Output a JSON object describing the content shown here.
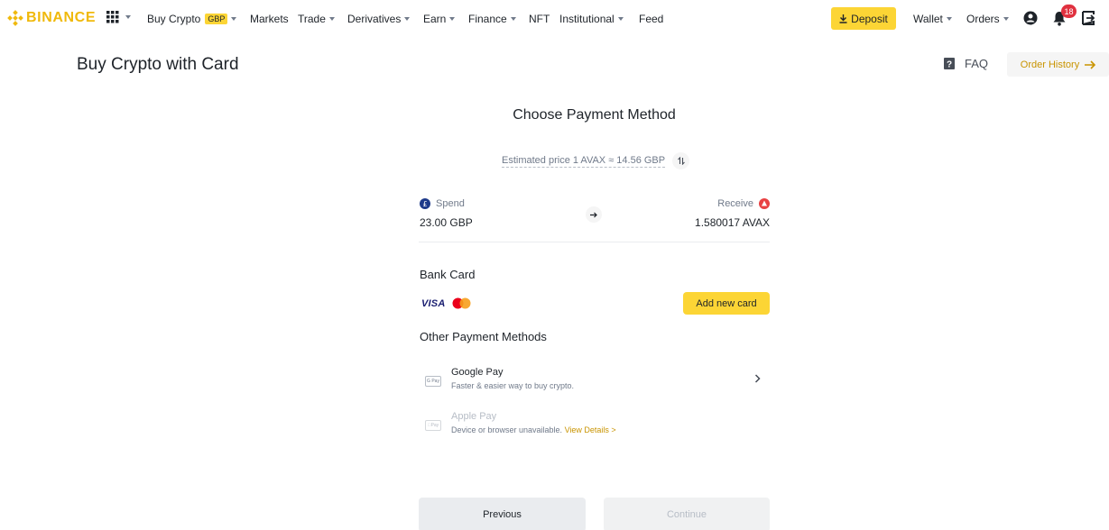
{
  "brand": {
    "name": "BINANCE",
    "color": "#F0B90B"
  },
  "nav": {
    "apps_icon": "grid-icon",
    "buy_crypto": "Buy Crypto",
    "currency_badge": "GBP",
    "markets": "Markets",
    "trade": "Trade",
    "derivatives": "Derivatives",
    "earn": "Earn",
    "finance": "Finance",
    "nft": "NFT",
    "institutional": "Institutional",
    "feed": "Feed",
    "deposit": "Deposit",
    "wallet": "Wallet",
    "orders": "Orders",
    "notification_count": "18"
  },
  "header": {
    "title": "Buy Crypto with Card",
    "faq": "FAQ",
    "order_history": "Order History"
  },
  "panel": {
    "title": "Choose Payment Method",
    "estimated_price": "Estimated price 1 AVAX ≈ 14.56 GBP",
    "spend_label": "Spend",
    "spend_value": "23.00 GBP",
    "receive_label": "Receive",
    "receive_value": "1.580017 AVAX",
    "bank_card_heading": "Bank Card",
    "visa_label": "VISA",
    "add_card": "Add new card",
    "other_heading": "Other Payment Methods",
    "methods": [
      {
        "name": "Google Pay",
        "description": "Faster & easier way to buy crypto.",
        "icon_text": "G Pay",
        "enabled": true
      },
      {
        "name": "Apple Pay",
        "description": "Device or browser unavailable.",
        "link": "View Details >",
        "icon_text": "Pay",
        "enabled": false
      }
    ],
    "previous": "Previous",
    "continue": "Continue"
  },
  "colors": {
    "accent": "#FCD535",
    "link": "#C99400",
    "badge": "#E0313F"
  }
}
